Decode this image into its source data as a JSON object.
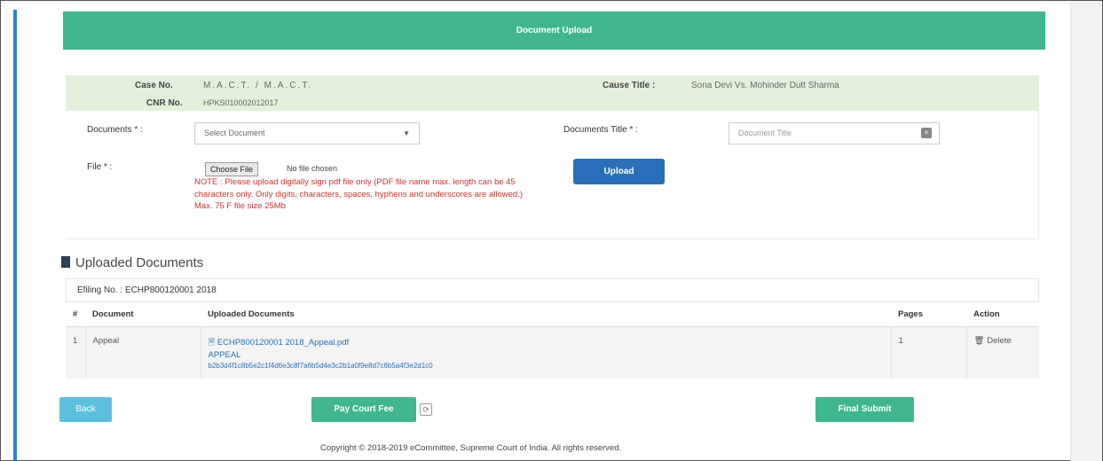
{
  "header": {
    "title": "Document Upload"
  },
  "case_info": {
    "case_no_label": "Case No.",
    "case_no_value": "M.A.C.T. / M.A.C.T.",
    "cnr_label": "CNR No.",
    "cnr_value": "HPKS010002012017",
    "cause_title_label": "Cause Title :",
    "cause_title_value": "Sona Devi Vs. Mohinder Dutt Sharma"
  },
  "form": {
    "documents_label": "Documents * :",
    "documents_selected": "Select Document",
    "documents_title_label": "Documents Title * :",
    "documents_title_placeholder": "Document Title",
    "file_label": "File * :",
    "choose_file_label": "Choose File",
    "no_file_text": "No file chosen",
    "note": "NOTE : Please upload digitally sign pdf file only (PDF file name max. length can be 45 characters only. Only digits, characters, spaces, hyphens and underscores are allowed.) Max. 75 F file size 25Mb",
    "upload_label": "Upload"
  },
  "uploaded_docs": {
    "heading": "Uploaded Documents",
    "efiling_text": "Efiling No. : ECHP800120001 2018",
    "columns": [
      "#",
      "Document",
      "Uploaded Documents",
      "Pages",
      "Action"
    ],
    "rows": [
      {
        "index": "1",
        "document": "Appeal",
        "file_name": "ECHP800120001 2018_Appeal.pdf",
        "sub_label": "APPEAL",
        "hash": "b2b3d4f1c8b5e2c1f4d6e3c8f7a6b5d4e3c2b1a0f9e8d7c6b5a4f3e2d1c0",
        "pages": "1",
        "action_label": "Delete"
      }
    ]
  },
  "buttons": {
    "back": "Back",
    "pay_court_fee": "Pay Court Fee",
    "final_submit": "Final Submit"
  },
  "footer": {
    "copyright": "Copyright © 2018-2019 eCommittee, Supreme Court of India. All rights reserved."
  },
  "colors": {
    "primary_green": "#3fb68f",
    "upload_blue": "#2a6fba",
    "back_cyan": "#5bc0de",
    "case_info_bg": "#e3f1dc",
    "note_red": "#d0312d"
  },
  "icons": [
    "document-icon",
    "dropdown-caret-icon",
    "clear-icon",
    "delete-icon",
    "fee-info-icon"
  ]
}
